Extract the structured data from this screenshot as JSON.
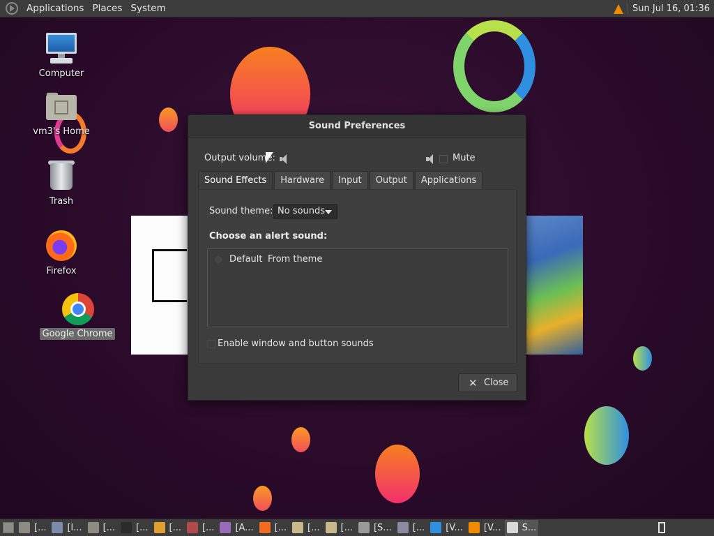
{
  "top_panel": {
    "menus": [
      "Applications",
      "Places",
      "System"
    ],
    "clock": "Sun Jul 16, 01:36"
  },
  "desktop_icons": [
    {
      "label": "Computer",
      "icon": "computer-icon"
    },
    {
      "label": "vm3's Home",
      "icon": "home-folder-icon"
    },
    {
      "label": "Trash",
      "icon": "trash-icon"
    },
    {
      "label": "Firefox",
      "icon": "firefox-icon"
    },
    {
      "label": "Google Chrome",
      "icon": "chrome-icon",
      "selected": true
    }
  ],
  "dialog": {
    "title": "Sound Preferences",
    "output_volume_label": "Output volume:",
    "mute_label": "Mute",
    "tabs": [
      "Sound Effects",
      "Hardware",
      "Input",
      "Output",
      "Applications"
    ],
    "active_tab": "Sound Effects",
    "sound_theme_label": "Sound theme:",
    "sound_theme_value": "No sounds",
    "alert_heading": "Choose an alert sound:",
    "alert_sounds": [
      {
        "name": "Default",
        "type": "From theme"
      }
    ],
    "enable_sounds_label": "Enable window and button sounds",
    "close_label": "Close"
  },
  "taskbar": {
    "tasks": [
      {
        "label": "[...",
        "icon": "folder-icon"
      },
      {
        "label": "[l...",
        "icon": "scanner-icon"
      },
      {
        "label": "[...",
        "icon": "folder-icon"
      },
      {
        "label": "[...",
        "icon": "terminal-icon"
      },
      {
        "label": "[...",
        "icon": "chrome-icon"
      },
      {
        "label": "[...",
        "icon": "app-icon"
      },
      {
        "label": "[A...",
        "icon": "image-viewer-icon"
      },
      {
        "label": "[...",
        "icon": "firefox-icon"
      },
      {
        "label": "[...",
        "icon": "document-icon"
      },
      {
        "label": "[...",
        "icon": "document-icon"
      },
      {
        "label": "[S...",
        "icon": "window-icon"
      },
      {
        "label": "[...",
        "icon": "media-icon"
      },
      {
        "label": "[V...",
        "icon": "vscode-icon"
      },
      {
        "label": "[V...",
        "icon": "vlc-icon"
      },
      {
        "label": "S...",
        "icon": "sound-icon",
        "active": true
      }
    ]
  },
  "colors": {
    "panel_bg": "#3c3c3c",
    "dialog_bg": "#3a3a3a",
    "desktop_bg": "#2b0d2c"
  }
}
